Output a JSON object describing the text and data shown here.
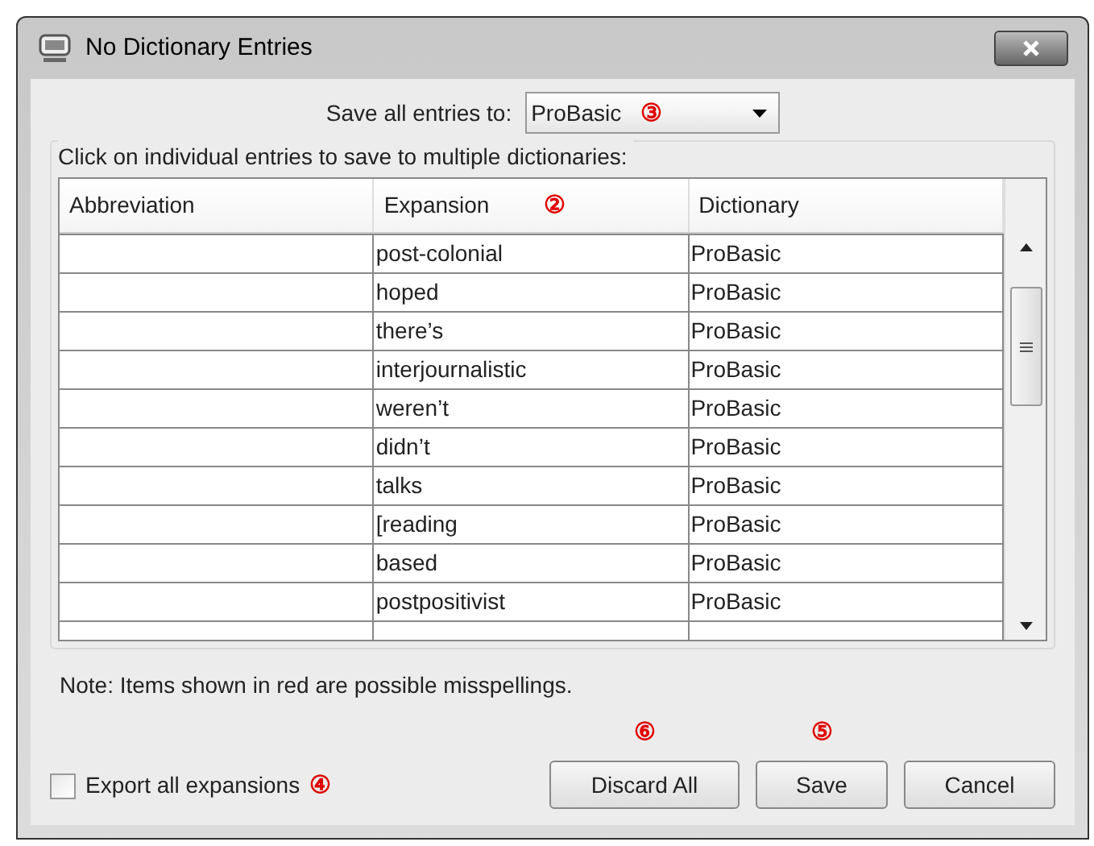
{
  "window": {
    "title": "No Dictionary Entries"
  },
  "save_all": {
    "label": "Save all entries to:",
    "value": "ProBasic",
    "callout": "③"
  },
  "group_label": "Click on individual entries to save to multiple dictionaries:",
  "table": {
    "columns": [
      {
        "label": "Abbreviation"
      },
      {
        "label": "Expansion",
        "callout": "②"
      },
      {
        "label": "Dictionary"
      }
    ],
    "rows": [
      {
        "abbreviation": "",
        "expansion": "post-colonial",
        "dictionary": "ProBasic"
      },
      {
        "abbreviation": "",
        "expansion": "hoped",
        "dictionary": "ProBasic"
      },
      {
        "abbreviation": "",
        "expansion": "there’s",
        "dictionary": "ProBasic"
      },
      {
        "abbreviation": "",
        "expansion": "interjournalistic",
        "dictionary": "ProBasic"
      },
      {
        "abbreviation": "",
        "expansion": "weren’t",
        "dictionary": "ProBasic"
      },
      {
        "abbreviation": "",
        "expansion": "didn’t",
        "dictionary": "ProBasic"
      },
      {
        "abbreviation": "",
        "expansion": "talks",
        "dictionary": "ProBasic"
      },
      {
        "abbreviation": "",
        "expansion": "[reading",
        "dictionary": "ProBasic"
      },
      {
        "abbreviation": "",
        "expansion": "based",
        "dictionary": "ProBasic"
      },
      {
        "abbreviation": "",
        "expansion": "postpositivist",
        "dictionary": "ProBasic"
      }
    ]
  },
  "note": "Note: Items shown in red are possible misspellings.",
  "export": {
    "label": "Export all expansions",
    "checked": false,
    "callout": "④"
  },
  "buttons": [
    {
      "label": "Discard All",
      "callout": "⑥"
    },
    {
      "label": "Save",
      "callout": "⑤"
    },
    {
      "label": "Cancel"
    }
  ]
}
